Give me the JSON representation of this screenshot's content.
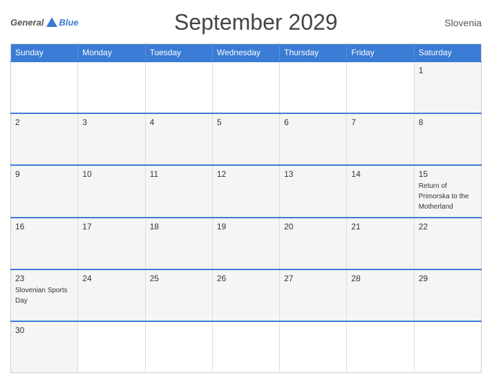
{
  "header": {
    "logo": {
      "general": "General",
      "blue": "Blue"
    },
    "title": "September 2029",
    "country": "Slovenia"
  },
  "calendar": {
    "weekdays": [
      "Sunday",
      "Monday",
      "Tuesday",
      "Wednesday",
      "Thursday",
      "Friday",
      "Saturday"
    ],
    "weeks": [
      [
        {
          "day": "",
          "event": "",
          "empty": true
        },
        {
          "day": "",
          "event": "",
          "empty": true
        },
        {
          "day": "",
          "event": "",
          "empty": true
        },
        {
          "day": "",
          "event": "",
          "empty": true
        },
        {
          "day": "",
          "event": "",
          "empty": true
        },
        {
          "day": "",
          "event": "",
          "empty": true
        },
        {
          "day": "1",
          "event": ""
        }
      ],
      [
        {
          "day": "2",
          "event": ""
        },
        {
          "day": "3",
          "event": ""
        },
        {
          "day": "4",
          "event": ""
        },
        {
          "day": "5",
          "event": ""
        },
        {
          "day": "6",
          "event": ""
        },
        {
          "day": "7",
          "event": ""
        },
        {
          "day": "8",
          "event": ""
        }
      ],
      [
        {
          "day": "9",
          "event": ""
        },
        {
          "day": "10",
          "event": ""
        },
        {
          "day": "11",
          "event": ""
        },
        {
          "day": "12",
          "event": ""
        },
        {
          "day": "13",
          "event": ""
        },
        {
          "day": "14",
          "event": ""
        },
        {
          "day": "15",
          "event": "Return of Primorska to the Motherland"
        }
      ],
      [
        {
          "day": "16",
          "event": ""
        },
        {
          "day": "17",
          "event": ""
        },
        {
          "day": "18",
          "event": ""
        },
        {
          "day": "19",
          "event": ""
        },
        {
          "day": "20",
          "event": ""
        },
        {
          "day": "21",
          "event": ""
        },
        {
          "day": "22",
          "event": ""
        }
      ],
      [
        {
          "day": "23",
          "event": "Slovenian Sports Day"
        },
        {
          "day": "24",
          "event": ""
        },
        {
          "day": "25",
          "event": ""
        },
        {
          "day": "26",
          "event": ""
        },
        {
          "day": "27",
          "event": ""
        },
        {
          "day": "28",
          "event": ""
        },
        {
          "day": "29",
          "event": ""
        }
      ],
      [
        {
          "day": "30",
          "event": ""
        },
        {
          "day": "",
          "event": "",
          "empty": true
        },
        {
          "day": "",
          "event": "",
          "empty": true
        },
        {
          "day": "",
          "event": "",
          "empty": true
        },
        {
          "day": "",
          "event": "",
          "empty": true
        },
        {
          "day": "",
          "event": "",
          "empty": true
        },
        {
          "day": "",
          "event": "",
          "empty": true
        }
      ]
    ]
  }
}
